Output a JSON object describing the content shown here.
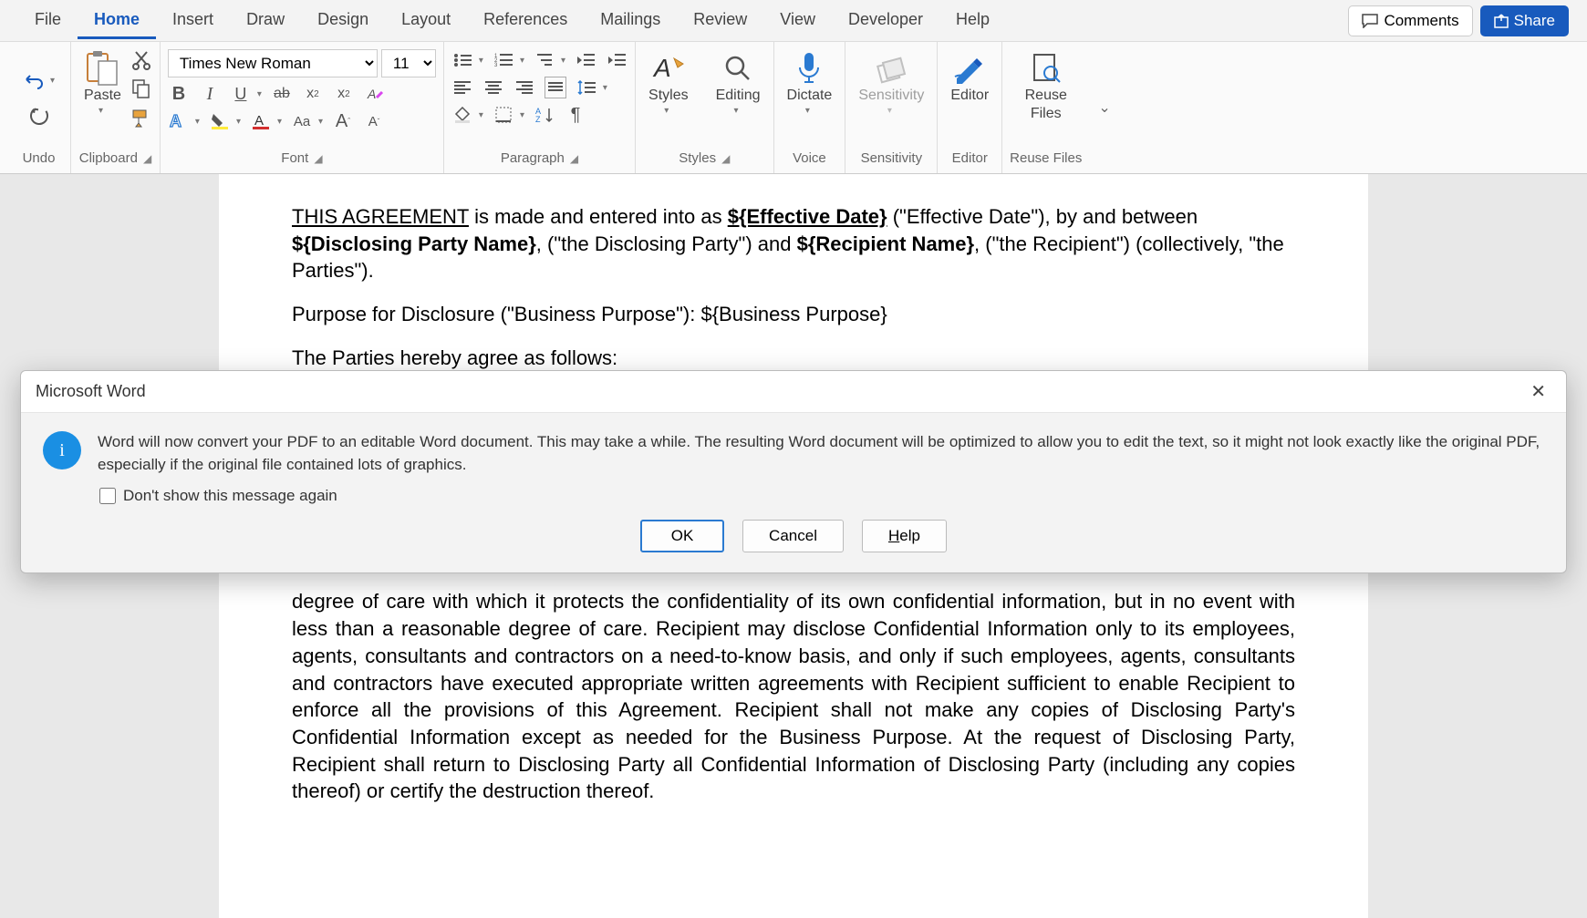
{
  "tabs": {
    "file": "File",
    "home": "Home",
    "insert": "Insert",
    "draw": "Draw",
    "design": "Design",
    "layout": "Layout",
    "references": "References",
    "mailings": "Mailings",
    "review": "Review",
    "view": "View",
    "developer": "Developer",
    "help": "Help"
  },
  "topbtns": {
    "comments": "Comments",
    "share": "Share"
  },
  "ribbon": {
    "undo": "Undo",
    "clipboard": {
      "paste": "Paste",
      "label": "Clipboard"
    },
    "font": {
      "name": "Times New Roman",
      "size": "11",
      "label": "Font"
    },
    "paragraph": {
      "label": "Paragraph"
    },
    "styles": {
      "styles": "Styles",
      "editing": "Editing",
      "label": "Styles"
    },
    "dictate": {
      "dictate": "Dictate",
      "label": "Voice"
    },
    "sensitivity": {
      "sensitivity": "Sensitivity",
      "label": "Sensitivity"
    },
    "editor": {
      "editor": "Editor",
      "label": "Editor"
    },
    "reuse": {
      "reuse1": "Reuse",
      "reuse2": "Files",
      "label": "Reuse Files"
    }
  },
  "doc": {
    "p1_lead": "THIS AGREEMENT",
    "p1_a": " is made and entered into as ",
    "p1_eff_lbl": "${Effective Date}",
    "p1_b": " (\"Effective Date\"), by and between ",
    "p1_disc": "${Disclosing Party Name}",
    "p1_c": ", (\"the Disclosing Party\") and ",
    "p1_rec": "${Recipient Name}",
    "p1_d": ", (\"the Recipient\") (collectively, \"the Parties\").",
    "p2": "Purpose for Disclosure (\"Business Purpose\"): ${Business Purpose}",
    "p3": "The Parties hereby agree as follows:",
    "p4": "degree of care with which it protects the confidentiality of its own confidential information, but in no event with less than a reasonable degree of care. Recipient may disclose Confidential Information only to its employees, agents, consultants and contractors on a need-to-know basis, and only if such employees, agents, consultants and contractors have executed appropriate written agreements with Recipient sufficient to enable Recipient to enforce all the provisions of this Agreement. Recipient shall not make any copies of Disclosing Party's Confidential Information except as needed for the Business Purpose. At the request of Disclosing Party, Recipient shall return to Disclosing Party all Confidential Information of Disclosing Party (including any copies thereof) or certify the destruction thereof."
  },
  "dialog": {
    "title": "Microsoft Word",
    "message": "Word will now convert your PDF to an editable Word document. This may take a while. The resulting Word document will be optimized to allow you to edit the text, so it might not look exactly like the original PDF, especially if the original file contained lots of graphics.",
    "dontshow": "Don't show this message again",
    "ok": "OK",
    "cancel": "Cancel",
    "help": "Help"
  }
}
